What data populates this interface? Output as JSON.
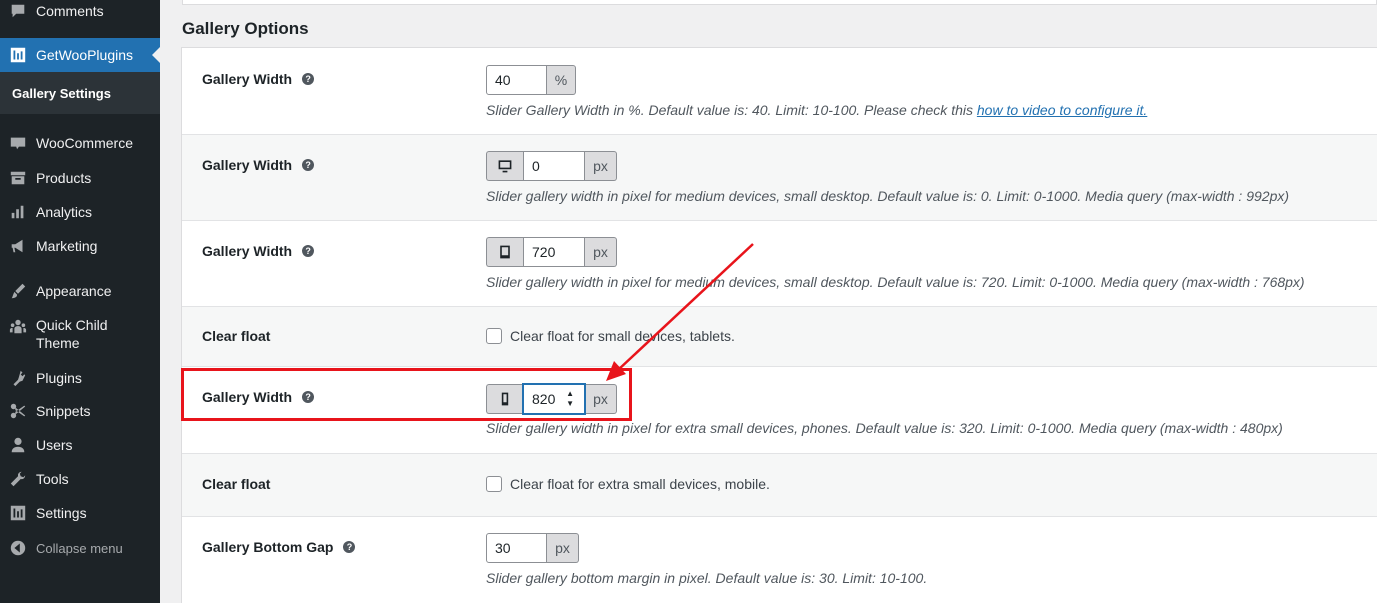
{
  "sidebar": {
    "items": [
      {
        "label": "Comments",
        "icon": "comment-icon"
      },
      {
        "label": "GetWooPlugins",
        "icon": "plugin-settings-icon",
        "active": true
      },
      {
        "label": "WooCommerce",
        "icon": "woo-icon"
      },
      {
        "label": "Products",
        "icon": "archive-icon"
      },
      {
        "label": "Analytics",
        "icon": "bar-chart-icon"
      },
      {
        "label": "Marketing",
        "icon": "megaphone-icon"
      },
      {
        "label": "Appearance",
        "icon": "paint-brush-icon"
      },
      {
        "label": "Quick Child Theme",
        "icon": "groups-icon"
      },
      {
        "label": "Plugins",
        "icon": "plug-icon"
      },
      {
        "label": "Snippets",
        "icon": "scissors-icon"
      },
      {
        "label": "Users",
        "icon": "user-icon"
      },
      {
        "label": "Tools",
        "icon": "wrench-icon"
      },
      {
        "label": "Settings",
        "icon": "settings-sliders-icon"
      },
      {
        "label": "Collapse menu",
        "icon": "collapse-icon"
      }
    ],
    "submenu": {
      "label": "Gallery Settings"
    }
  },
  "section": {
    "title": "Gallery Options"
  },
  "rows": [
    {
      "label": "Gallery Width",
      "value": "40",
      "unit": "%",
      "desc": "Slider Gallery Width in %. Default value is: 40. Limit: 10-100. Please check this ",
      "link": "how to video to configure it."
    },
    {
      "label": "Gallery Width",
      "value": "0",
      "unit": "px",
      "device_icon": "desktop-icon",
      "desc": "Slider gallery width in pixel for medium devices, small desktop. Default value is: 0. Limit: 0-1000. Media query (max-width : 992px)"
    },
    {
      "label": "Gallery Width",
      "value": "720",
      "unit": "px",
      "device_icon": "tablet-icon",
      "desc": "Slider gallery width in pixel for medium devices, small desktop. Default value is: 720. Limit: 0-1000. Media query (max-width : 768px)"
    },
    {
      "label": "Clear float",
      "checkbox_label": "Clear float for small devices, tablets."
    },
    {
      "label": "Gallery Width",
      "value": "820",
      "unit": "px",
      "device_icon": "smartphone-icon",
      "desc": "Slider gallery width in pixel for extra small devices, phones. Default value is: 320. Limit: 0-1000. Media query (max-width : 480px)"
    },
    {
      "label": "Clear float",
      "checkbox_label": "Clear float for extra small devices, mobile."
    },
    {
      "label": "Gallery Bottom Gap",
      "value": "30",
      "unit": "px",
      "desc": "Slider gallery bottom margin in pixel. Default value is: 30. Limit: 10-100."
    }
  ],
  "colors": {
    "sidebar": "#1d2327",
    "active": "#2271b1",
    "annotation": "#e8141b"
  }
}
